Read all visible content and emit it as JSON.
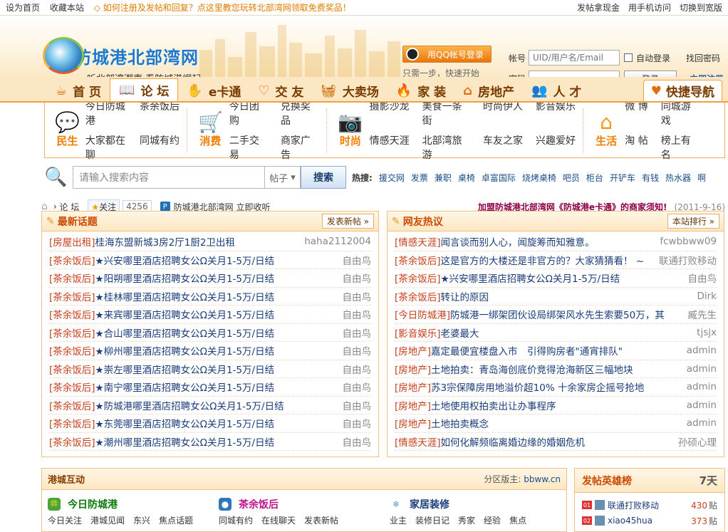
{
  "topbar": {
    "set_home": "设为首页",
    "bookmark": "收藏本站",
    "notice": "◇ 如何注册及发帖和回复？点这里教您玩转北部湾网领取免费奖品！",
    "earn": "发帖拿现金",
    "mobile": "用手机访问",
    "wide": "切换到宽版"
  },
  "logo": {
    "name": "防城港北部湾网",
    "slogan": "听北部湾潮声 看防城港崛起"
  },
  "qq": {
    "button": "用QQ帐号登录",
    "tip": "只需一步，快速开始"
  },
  "login": {
    "account_label": "帐号",
    "account_placeholder": "UID/用户名/Email",
    "auto": "自动登录",
    "find_pwd": "找回密码",
    "pwd_label": "密码",
    "login_btn": "登录",
    "register": "立即注册"
  },
  "nav": {
    "items": [
      {
        "label": "首 页",
        "icon": "☕"
      },
      {
        "label": "论 坛",
        "icon": "📖"
      },
      {
        "label": "e卡通",
        "icon": "✋"
      },
      {
        "label": "交 友",
        "icon": "♡"
      },
      {
        "label": "大卖场",
        "icon": "🧺"
      },
      {
        "label": "家 装",
        "icon": "🔥"
      },
      {
        "label": "房地产",
        "icon": "⌂"
      },
      {
        "label": "人 才",
        "icon": "👥"
      }
    ],
    "quick": "快捷导航"
  },
  "cats": [
    {
      "name": "民生",
      "links": [
        "今日防城港",
        "茶余饭后",
        "大家都在聊",
        "同城有约"
      ]
    },
    {
      "name": "消费",
      "links": [
        "今日团购",
        "兑换奖品",
        "二手交易",
        "商家广告"
      ]
    },
    {
      "name": "时尚",
      "links": [
        "摄影沙龙",
        "美食一条街",
        "时尚伊人",
        "影音娱乐",
        "情感天涯",
        "北部湾旅游",
        "车友之家",
        "兴趣爱好"
      ]
    },
    {
      "name": "生活",
      "links": [
        "微 博",
        "同城游戏",
        "淘 帖",
        "榜上有名"
      ]
    }
  ],
  "search": {
    "placeholder": "请输入搜索内容",
    "scope": "帖子",
    "button": "搜索",
    "hot_label": "热搜:",
    "hot": [
      "援交网",
      "发票",
      "兼职",
      "桌椅",
      "卓富国际",
      "烧烤桌椅",
      "吧员",
      "柜台",
      "开铲车",
      "有钱",
      "热水器",
      "啊"
    ]
  },
  "crumb": {
    "forum": "论 坛",
    "follow": "关注",
    "count": "4256",
    "site": "防城港北部湾网",
    "collect": "立即收听",
    "announce": "加盟防城港北部湾网《防城港e卡通》的商家须知!",
    "date": "(2011-9-16)"
  },
  "latest": {
    "title": "最新话题",
    "button": "发表新帖 »",
    "items": [
      {
        "tag": "[房屋出租]",
        "title": "桂海东盟新城3房2厅1厨2卫出租",
        "author": "haha2112004"
      },
      {
        "tag": "[茶余饭后]",
        "title": "★兴安哪里酒店招聘女公Ω关月1-5万/日结",
        "author": "自由鸟"
      },
      {
        "tag": "[茶余饭后]",
        "title": "★阳朔哪里酒店招聘女公Ω关月1-5万/日结",
        "author": "自由鸟"
      },
      {
        "tag": "[茶余饭后]",
        "title": "★桂林哪里酒店招聘女公Ω关月1-5万/日结",
        "author": "自由鸟"
      },
      {
        "tag": "[茶余饭后]",
        "title": "★来宾哪里酒店招聘女公Ω关月1-5万/日结",
        "author": "自由鸟"
      },
      {
        "tag": "[茶余饭后]",
        "title": "★合山哪里酒店招聘女公Ω关月1-5万/日结",
        "author": "自由鸟"
      },
      {
        "tag": "[茶余饭后]",
        "title": "★柳州哪里酒店招聘女公Ω关月1-5万/日结",
        "author": "自由鸟"
      },
      {
        "tag": "[茶余饭后]",
        "title": "★崇左哪里酒店招聘女公Ω关月1-5万/日结",
        "author": "自由鸟"
      },
      {
        "tag": "[茶余饭后]",
        "title": "★南宁哪里酒店招聘女公Ω关月1-5万/日结",
        "author": "自由鸟"
      },
      {
        "tag": "[茶余饭后]",
        "title": "★防城港哪里酒店招聘女公Ω关月1-5万/日结",
        "author": "自由鸟"
      },
      {
        "tag": "[茶余饭后]",
        "title": "★东莞哪里酒店招聘女公Ω关月1-5万/日结",
        "author": "自由鸟"
      },
      {
        "tag": "[茶余饭后]",
        "title": "★潮州哪里酒店招聘女公Ω关月1-5万/日结",
        "author": "自由鸟"
      }
    ]
  },
  "hot": {
    "title": "网友热议",
    "button": "本站排行 »",
    "items": [
      {
        "tag": "[情感天涯]",
        "title": "闻言谈而别人心，闻旋筹而知雅意。",
        "author": "fcwbbww09"
      },
      {
        "tag": "[茶余饭后]",
        "title": "这是官方的大楼还是非官方的？大家猜猜看！ ~",
        "author": "联通打败移动"
      },
      {
        "tag": "[茶余饭后]",
        "title": "★兴安哪里酒店招聘女公Ω关月1-5万/日结",
        "author": "自由鸟"
      },
      {
        "tag": "[茶余饭后]",
        "title": "转让的原因",
        "author": "Dirk"
      },
      {
        "tag": "[今日防城港]",
        "title": "防城港一绑架团伙设局绑架风水先生索要50万，其",
        "author": "臧先生"
      },
      {
        "tag": "[影音娱乐]",
        "title": "老婆最大",
        "author": "tjsjx"
      },
      {
        "tag": "[房地产]",
        "title": "嘉定最便宜楼盘入市　引得购房者\"通宵排队\"",
        "author": "admin"
      },
      {
        "tag": "[房地产]",
        "title": "土地拍卖：青岛海创底价竞得沧海新区三幅地块",
        "author": "admin"
      },
      {
        "tag": "[房地产]",
        "title": "苏3宗保障房用地溢价超10% 十余家房企摇号抢地",
        "author": "admin"
      },
      {
        "tag": "[房地产]",
        "title": "土地使用权拍卖出让办事程序",
        "author": "admin"
      },
      {
        "tag": "[房地产]",
        "title": "土地拍卖概念",
        "author": "admin"
      },
      {
        "tag": "[情感天涯]",
        "title": "如何化解频临离婚边缘的婚姻危机",
        "author": "孙硕心理"
      }
    ]
  },
  "harbor": {
    "title": "港城互动",
    "zone_label": "分区版主:",
    "zone_value": "bbww.cn",
    "zones": [
      {
        "name": "今日防城港",
        "color": "#0a7a0a",
        "links": [
          "今日关注",
          "港城见闻",
          "东兴",
          "焦点话题"
        ]
      },
      {
        "name": "茶余饭后",
        "color": "#c0168c",
        "links": [
          "同城有约",
          "在线聊天",
          "发表新帖"
        ]
      },
      {
        "name": "家居装修",
        "color": "#1a3d7a",
        "links": [
          "业主",
          "装修日记",
          "秀家",
          "经验",
          "焦点"
        ]
      }
    ]
  },
  "heroes": {
    "title": "发帖英雄榜",
    "period": "7天",
    "items": [
      {
        "no": "01",
        "name": "联通打败移动",
        "count": "430",
        "unit": "贴"
      },
      {
        "no": "02",
        "name": "xiao45hua",
        "count": "373",
        "unit": "贴"
      }
    ]
  }
}
